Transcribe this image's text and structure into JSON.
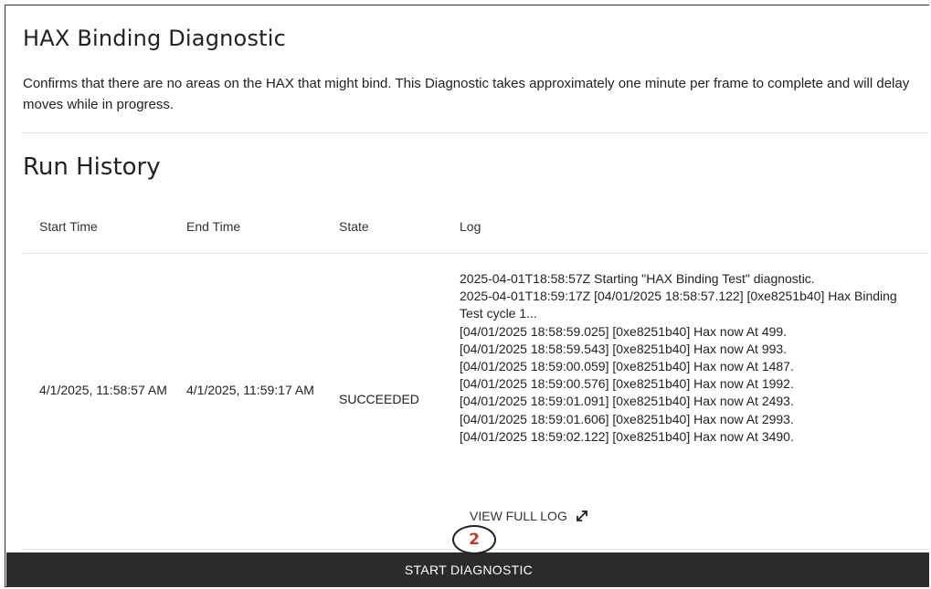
{
  "header": {
    "title": "HAX Binding Diagnostic",
    "description": "Confirms that there are no areas on the HAX that might bind. This Diagnostic takes approximately one minute per frame to complete and will delay moves while in progress."
  },
  "run_history": {
    "title": "Run History",
    "columns": [
      "Start Time",
      "End Time",
      "State",
      "Log"
    ],
    "rows": [
      {
        "start_time": "4/1/2025, 11:58:57 AM",
        "end_time": "4/1/2025, 11:59:17 AM",
        "state": "SUCCEEDED",
        "log_lines": [
          "2025-04-01T18:58:57Z Starting \"HAX Binding Test\" diagnostic.",
          "2025-04-01T18:59:17Z [04/01/2025 18:58:57.122] [0xe8251b40] Hax Binding Test cycle 1...",
          "[04/01/2025 18:58:59.025] [0xe8251b40] Hax now At 499.",
          "[04/01/2025 18:58:59.543] [0xe8251b40] Hax now At 993.",
          "[04/01/2025 18:59:00.059] [0xe8251b40] Hax now At 1487.",
          "[04/01/2025 18:59:00.576] [0xe8251b40] Hax now At 1992.",
          "[04/01/2025 18:59:01.091] [0xe8251b40] Hax now At 2493.",
          "[04/01/2025 18:59:01.606] [0xe8251b40] Hax now At 2993.",
          "[04/01/2025 18:59:02.122] [0xe8251b40] Hax now At 3490."
        ],
        "view_full_log_label": "VIEW FULL LOG",
        "view_full_log_icon": "expand-arrows-icon"
      }
    ]
  },
  "annotation": {
    "callout_number": "2",
    "callout_color": "#c0392b"
  },
  "actions": {
    "start_label": "START DIAGNOSTIC",
    "start_bg": "#2b2b2b"
  }
}
